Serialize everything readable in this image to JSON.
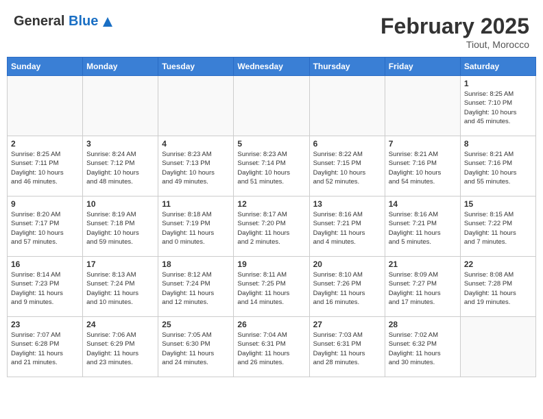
{
  "header": {
    "logo_general": "General",
    "logo_blue": "Blue",
    "month_title": "February 2025",
    "location": "Tiout, Morocco"
  },
  "days_of_week": [
    "Sunday",
    "Monday",
    "Tuesday",
    "Wednesday",
    "Thursday",
    "Friday",
    "Saturday"
  ],
  "weeks": [
    [
      {
        "day": "",
        "info": ""
      },
      {
        "day": "",
        "info": ""
      },
      {
        "day": "",
        "info": ""
      },
      {
        "day": "",
        "info": ""
      },
      {
        "day": "",
        "info": ""
      },
      {
        "day": "",
        "info": ""
      },
      {
        "day": "1",
        "info": "Sunrise: 8:25 AM\nSunset: 7:10 PM\nDaylight: 10 hours\nand 45 minutes."
      }
    ],
    [
      {
        "day": "2",
        "info": "Sunrise: 8:25 AM\nSunset: 7:11 PM\nDaylight: 10 hours\nand 46 minutes."
      },
      {
        "day": "3",
        "info": "Sunrise: 8:24 AM\nSunset: 7:12 PM\nDaylight: 10 hours\nand 48 minutes."
      },
      {
        "day": "4",
        "info": "Sunrise: 8:23 AM\nSunset: 7:13 PM\nDaylight: 10 hours\nand 49 minutes."
      },
      {
        "day": "5",
        "info": "Sunrise: 8:23 AM\nSunset: 7:14 PM\nDaylight: 10 hours\nand 51 minutes."
      },
      {
        "day": "6",
        "info": "Sunrise: 8:22 AM\nSunset: 7:15 PM\nDaylight: 10 hours\nand 52 minutes."
      },
      {
        "day": "7",
        "info": "Sunrise: 8:21 AM\nSunset: 7:16 PM\nDaylight: 10 hours\nand 54 minutes."
      },
      {
        "day": "8",
        "info": "Sunrise: 8:21 AM\nSunset: 7:16 PM\nDaylight: 10 hours\nand 55 minutes."
      }
    ],
    [
      {
        "day": "9",
        "info": "Sunrise: 8:20 AM\nSunset: 7:17 PM\nDaylight: 10 hours\nand 57 minutes."
      },
      {
        "day": "10",
        "info": "Sunrise: 8:19 AM\nSunset: 7:18 PM\nDaylight: 10 hours\nand 59 minutes."
      },
      {
        "day": "11",
        "info": "Sunrise: 8:18 AM\nSunset: 7:19 PM\nDaylight: 11 hours\nand 0 minutes."
      },
      {
        "day": "12",
        "info": "Sunrise: 8:17 AM\nSunset: 7:20 PM\nDaylight: 11 hours\nand 2 minutes."
      },
      {
        "day": "13",
        "info": "Sunrise: 8:16 AM\nSunset: 7:21 PM\nDaylight: 11 hours\nand 4 minutes."
      },
      {
        "day": "14",
        "info": "Sunrise: 8:16 AM\nSunset: 7:21 PM\nDaylight: 11 hours\nand 5 minutes."
      },
      {
        "day": "15",
        "info": "Sunrise: 8:15 AM\nSunset: 7:22 PM\nDaylight: 11 hours\nand 7 minutes."
      }
    ],
    [
      {
        "day": "16",
        "info": "Sunrise: 8:14 AM\nSunset: 7:23 PM\nDaylight: 11 hours\nand 9 minutes."
      },
      {
        "day": "17",
        "info": "Sunrise: 8:13 AM\nSunset: 7:24 PM\nDaylight: 11 hours\nand 10 minutes."
      },
      {
        "day": "18",
        "info": "Sunrise: 8:12 AM\nSunset: 7:24 PM\nDaylight: 11 hours\nand 12 minutes."
      },
      {
        "day": "19",
        "info": "Sunrise: 8:11 AM\nSunset: 7:25 PM\nDaylight: 11 hours\nand 14 minutes."
      },
      {
        "day": "20",
        "info": "Sunrise: 8:10 AM\nSunset: 7:26 PM\nDaylight: 11 hours\nand 16 minutes."
      },
      {
        "day": "21",
        "info": "Sunrise: 8:09 AM\nSunset: 7:27 PM\nDaylight: 11 hours\nand 17 minutes."
      },
      {
        "day": "22",
        "info": "Sunrise: 8:08 AM\nSunset: 7:28 PM\nDaylight: 11 hours\nand 19 minutes."
      }
    ],
    [
      {
        "day": "23",
        "info": "Sunrise: 7:07 AM\nSunset: 6:28 PM\nDaylight: 11 hours\nand 21 minutes."
      },
      {
        "day": "24",
        "info": "Sunrise: 7:06 AM\nSunset: 6:29 PM\nDaylight: 11 hours\nand 23 minutes."
      },
      {
        "day": "25",
        "info": "Sunrise: 7:05 AM\nSunset: 6:30 PM\nDaylight: 11 hours\nand 24 minutes."
      },
      {
        "day": "26",
        "info": "Sunrise: 7:04 AM\nSunset: 6:31 PM\nDaylight: 11 hours\nand 26 minutes."
      },
      {
        "day": "27",
        "info": "Sunrise: 7:03 AM\nSunset: 6:31 PM\nDaylight: 11 hours\nand 28 minutes."
      },
      {
        "day": "28",
        "info": "Sunrise: 7:02 AM\nSunset: 6:32 PM\nDaylight: 11 hours\nand 30 minutes."
      },
      {
        "day": "",
        "info": ""
      }
    ]
  ]
}
